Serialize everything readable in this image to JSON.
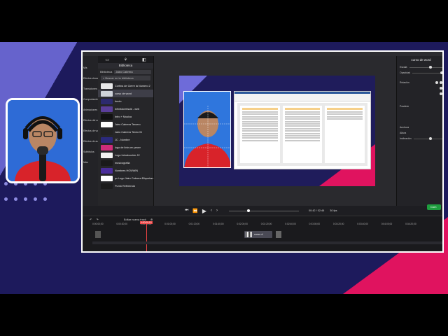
{
  "library": {
    "tab_title": "Biblioteca",
    "dropdown_label": "Biblioteca",
    "dropdown_value": "Jairo Cabrera",
    "search_placeholder": "Buscar en la biblioteca",
    "items": [
      {
        "name": "Cortina de Cierre la Numero 2",
        "color": "#e8e8e8"
      },
      {
        "name": "curso de word",
        "color": "#cfd3da"
      },
      {
        "name": "fondo",
        "color": "#2c2a6e"
      },
      {
        "name": "Infinitokreitsclk - web",
        "color": "#5b3e9a"
      },
      {
        "name": "Intro + Musica",
        "color": "#111111"
      },
      {
        "name": "Jairo Cabrera Tercero",
        "color": "#ffffff"
      },
      {
        "name": "Jairo Cabrera Tercio 01",
        "color": "#222222"
      },
      {
        "name": "JC - Nombre",
        "color": "#2b2a7c"
      },
      {
        "name": "logo de links en pecer",
        "color": "#cf2d7a"
      },
      {
        "name": "Logo Introducción JC",
        "color": "#f2f2f2"
      },
      {
        "name": "musicografia",
        "color": "#1a1a1a"
      },
      {
        "name": "Nombres HOWWIN",
        "color": "#4a2d9a"
      },
      {
        "name": "pc Logo Jairo Cabrera Etiquetando...",
        "color": "#ffffff"
      },
      {
        "name": "Punto Referencia",
        "color": "#1c1c1c"
      }
    ]
  },
  "left_strip": [
    "",
    "Mis",
    "Efectos visuales",
    "Transiciones",
    "Comportamientos",
    "Animaciones",
    "Efectos del cursor",
    "Efectos de voz",
    "Efectos de audio",
    "Subtítulos",
    "Más"
  ],
  "properties": {
    "title": "curso de word",
    "labels": {
      "escala": "Escala",
      "opacidad": "Opacidad",
      "rotacion": "Rotación",
      "posicion": "Posición",
      "anchura": "Anchura",
      "altura": "Altura",
      "inclinacion": "Inclinación"
    },
    "share_label": "Com"
  },
  "playback": {
    "time": "00:42 / 02:46",
    "fps": "30 fps"
  },
  "timeline": {
    "tool_label": "Editar nueva track",
    "playhead": "0:00:00;15",
    "ticks": [
      "0:00:00;00",
      "0:00:20;00",
      "0:00:40;00",
      "0:01:00;00",
      "0:01:20;00",
      "0:01:40;00",
      "0:02:00;00",
      "0:02:20;00",
      "0:02:40;00",
      "0:03:00;00",
      "0:03:20;00",
      "0:03:40;00",
      "0:04:00;00",
      "0:04:20;00"
    ],
    "clip_label": "curso d"
  }
}
